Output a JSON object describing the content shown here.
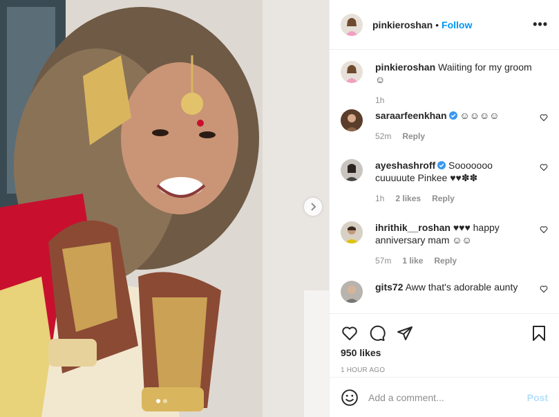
{
  "header": {
    "username": "pinkieroshan",
    "separator": "•",
    "follow_label": "Follow",
    "more_label": "•••"
  },
  "photo": {
    "next_icon": "chevron-right-icon",
    "carousel_dots": 2,
    "active_dot": 1
  },
  "caption": {
    "username": "pinkieroshan",
    "text": "Waiiting for my groom ☺",
    "time": "1h"
  },
  "comments": [
    {
      "username": "saraarfeenkhan",
      "verified": true,
      "text": "☺☺☺☺",
      "time": "52m",
      "likes": "",
      "reply_label": "Reply"
    },
    {
      "username": "ayeshashroff",
      "verified": true,
      "text": "Sooooooo cuuuuute Pinkee ♥♥✽✽",
      "time": "1h",
      "likes": "2 likes",
      "reply_label": "Reply"
    },
    {
      "username": "ihrithik__roshan",
      "verified": false,
      "text": "♥♥♥ happy anniversary mam ☺☺",
      "time": "57m",
      "likes": "1 like",
      "reply_label": "Reply"
    },
    {
      "username": "gits72",
      "verified": false,
      "text": "Aww that's adorable aunty",
      "time": "",
      "likes": "",
      "reply_label": ""
    }
  ],
  "actions": {
    "like_icon": "heart-icon",
    "comment_icon": "comment-icon",
    "share_icon": "share-icon",
    "save_icon": "bookmark-icon",
    "likes_count": "950 likes",
    "timestamp": "1 HOUR AGO"
  },
  "add_comment": {
    "placeholder": "Add a comment...",
    "post_label": "Post"
  },
  "colors": {
    "accent": "#0095f6",
    "post_disabled": "#b2dffc",
    "muted": "#8e8e8e",
    "text": "#262626"
  }
}
